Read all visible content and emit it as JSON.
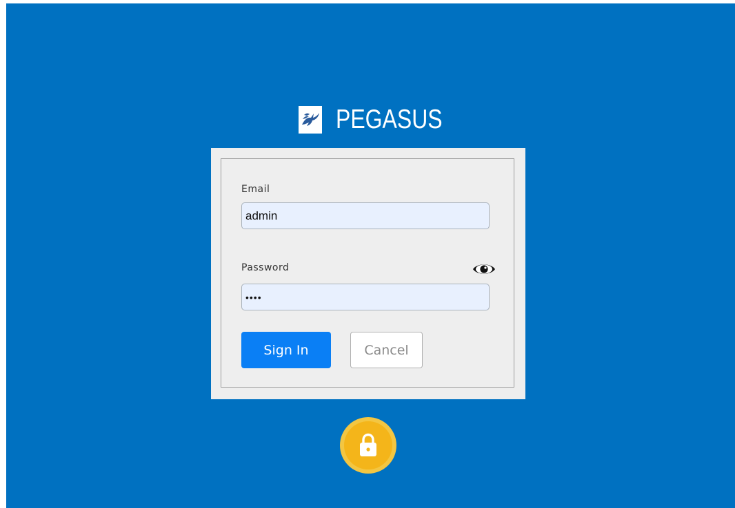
{
  "brand": {
    "name": "PEGASUS",
    "logo_icon": "pegasus-logo-icon"
  },
  "form": {
    "email_label": "Email",
    "email_value": "admin",
    "password_label": "Password",
    "password_value": "••••",
    "show_password_icon": "eye-icon",
    "sign_in_label": "Sign In",
    "cancel_label": "Cancel"
  },
  "footer": {
    "lock_icon": "lock-icon"
  },
  "colors": {
    "background": "#0071c1",
    "card": "#eeeeee",
    "input": "#e8f0fe",
    "primary_button": "#0a7ff5",
    "lock_badge": "#f4b51a"
  }
}
